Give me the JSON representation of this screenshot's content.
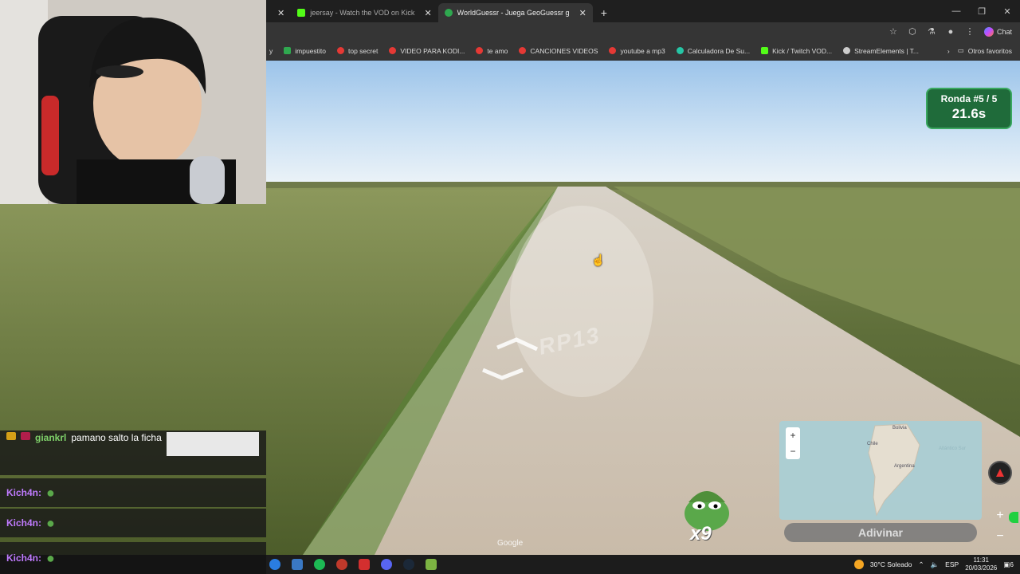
{
  "browser": {
    "tabs": [
      {
        "label": "jeersay - Watch the VOD on Kick",
        "icon_color": "#53fc18",
        "active": false
      },
      {
        "label": "WorldGuessr - Juega GeoGuessr g",
        "icon_color": "#2fa84f",
        "active": true
      }
    ],
    "new_tab": "+",
    "chat_label": "Chat",
    "bookmarks": [
      {
        "label": "impuestito",
        "color": "#2fa84f"
      },
      {
        "label": "top secret",
        "color": "#e53935"
      },
      {
        "label": "VIDEO PARA KODI...",
        "color": "#e53935"
      },
      {
        "label": "te amo",
        "color": "#e53935"
      },
      {
        "label": "CANCIONES VIDEOS",
        "color": "#e53935"
      },
      {
        "label": "youtube a mp3",
        "color": "#e53935"
      },
      {
        "label": "Calculadora De Su...",
        "color": "#26c6a6"
      },
      {
        "label": "Kick / Twitch VOD...",
        "color": "#53fc18"
      },
      {
        "label": "StreamElements | T...",
        "color": "#cccccc"
      }
    ],
    "other_bookmarks": "Otros favoritos"
  },
  "game": {
    "round_label": "Ronda #5 / 5",
    "timer": "21.6s",
    "road_marking": "RP13",
    "guess_button": "Adivinar",
    "map_labels": {
      "bolivia": "Bolivia",
      "chile": "Chile",
      "argentina": "Argentina",
      "atlantic": "Atlántico Sur"
    },
    "zoom_in": "+",
    "zoom_out": "−",
    "attribution": "Google",
    "combo": "x9"
  },
  "chat": {
    "messages": [
      {
        "user": "giankrl",
        "text": "pamano salto la ficha"
      },
      {
        "user": "Kich4n:",
        "text": ""
      },
      {
        "user": "Kich4n:",
        "text": ""
      },
      {
        "user": "Kich4n:",
        "text": ""
      }
    ]
  },
  "taskbar": {
    "weather": "30°C Soleado",
    "lang": "ESP",
    "time": "11:31",
    "date": "20/03/2026",
    "notif_count": "6"
  }
}
